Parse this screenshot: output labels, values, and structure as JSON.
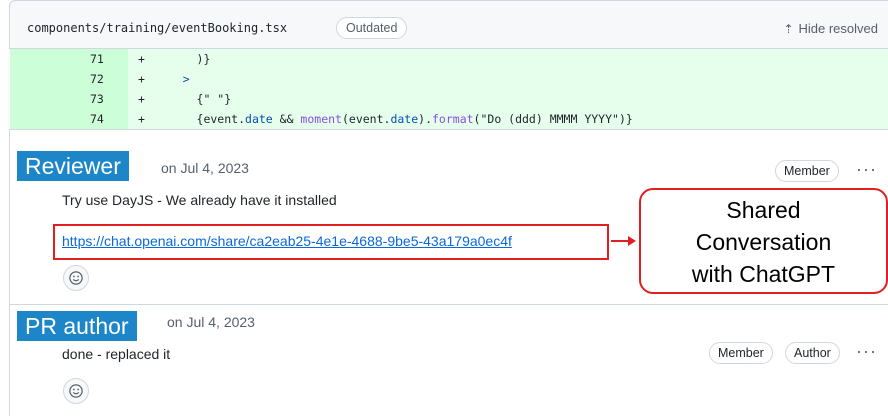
{
  "file": {
    "path": "components/training/eventBooking.tsx",
    "outdated_label": "Outdated",
    "hide_resolved_label": "Hide resolved"
  },
  "diff": [
    {
      "num": "71",
      "sign": "+",
      "code": "      )}"
    },
    {
      "num": "72",
      "sign": "+",
      "code": "    >"
    },
    {
      "num": "73",
      "sign": "+",
      "code": "      {\" \"}"
    },
    {
      "num": "74",
      "sign": "+",
      "code": "      {event.date && moment(event.date).format(\"Do (ddd) MMMM YYYY\")}"
    }
  ],
  "comments": [
    {
      "author_label": "Reviewer",
      "date": "on Jul 4, 2023",
      "text": "Try use DayJS - We already have it installed",
      "link": "https://chat.openai.com/share/ca2eab25-4e1e-4688-9be5-43a179a0ec4f",
      "badges": [
        "Member"
      ]
    },
    {
      "author_label": "PR author",
      "date": "on Jul 4, 2023",
      "text": "done - replaced it",
      "badges": [
        "Member",
        "Author"
      ]
    }
  ],
  "callout": {
    "lines": [
      "Shared",
      "Conversation",
      "with ChatGPT"
    ]
  },
  "colors": {
    "annotation_blue": "#1c86c9",
    "annotation_red": "#e02020",
    "diff_add_bg": "#e6ffec",
    "link": "#0969da"
  },
  "icons": [
    "unfold-icon",
    "kebab-icon",
    "smiley-icon",
    "arrow-right-icon"
  ]
}
